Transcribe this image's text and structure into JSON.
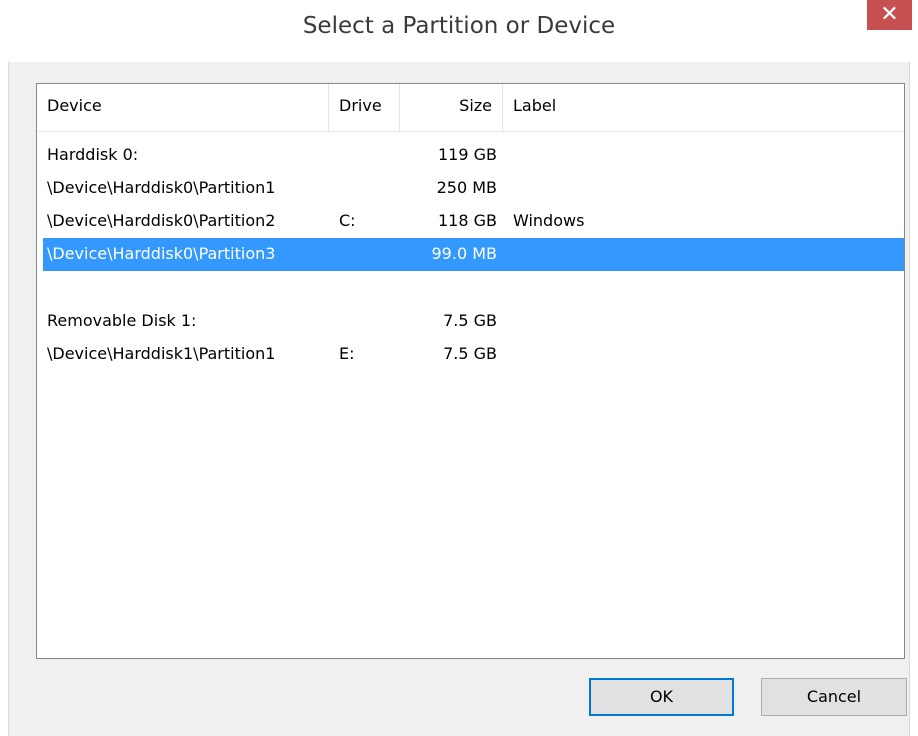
{
  "window": {
    "title": "Select a Partition or Device",
    "close_glyph": "✕"
  },
  "list": {
    "columns": [
      "Device",
      "Drive",
      "Size",
      "Label"
    ],
    "rows": [
      {
        "device": "Harddisk 0:",
        "drive": "",
        "size": "119 GB",
        "label": "",
        "selected": false
      },
      {
        "device": "\\Device\\Harddisk0\\Partition1",
        "drive": "",
        "size": "250 MB",
        "label": "",
        "selected": false
      },
      {
        "device": "\\Device\\Harddisk0\\Partition2",
        "drive": "C:",
        "size": "118 GB",
        "label": "Windows",
        "selected": false
      },
      {
        "device": "\\Device\\Harddisk0\\Partition3",
        "drive": "",
        "size": "99.0 MB",
        "label": "",
        "selected": true
      },
      {
        "device": "",
        "drive": "",
        "size": "",
        "label": "",
        "selected": false
      },
      {
        "device": "Removable Disk 1:",
        "drive": "",
        "size": "7.5 GB",
        "label": "",
        "selected": false
      },
      {
        "device": "\\Device\\Harddisk1\\Partition1",
        "drive": "E:",
        "size": "7.5 GB",
        "label": "",
        "selected": false
      }
    ]
  },
  "buttons": {
    "ok_label": "OK",
    "cancel_label": "Cancel"
  },
  "colors": {
    "selection": "#3399ff",
    "close_button": "#c75050",
    "default_button_border": "#0078d7"
  },
  "icons": {
    "close": "close-icon"
  }
}
